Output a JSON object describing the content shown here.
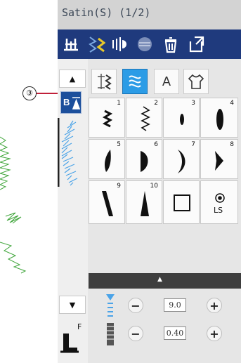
{
  "title": "Satin(S) (1/2)",
  "callout": {
    "label": "③"
  },
  "toolbar": {
    "icons": [
      "presser-foot-position-icon",
      "stitch-mirror-vertical-icon",
      "mirror-horizontal-icon",
      "hidden-icon",
      "delete-icon",
      "return-icon"
    ]
  },
  "tabs": [
    "stitch-group-icon",
    "satin-pattern-icon",
    "A",
    "shirt-icon"
  ],
  "scroll": {
    "up": "▲",
    "down": "▼"
  },
  "patterns": [
    {
      "num": "1"
    },
    {
      "num": "2"
    },
    {
      "num": "3"
    },
    {
      "num": "4"
    },
    {
      "num": "5"
    },
    {
      "num": "6"
    },
    {
      "num": "7"
    },
    {
      "num": "8"
    },
    {
      "num": "9"
    },
    {
      "num": "10"
    },
    {
      "num": ""
    },
    {
      "num": "",
      "label": "LS"
    }
  ],
  "width_value": "9.0",
  "density_value": "0.40",
  "minus": "−",
  "plus": "+",
  "foot": {
    "letter": "F"
  },
  "colors": {
    "toolbar": "#1f3a7d",
    "selected_tab": "#2c9ce6",
    "embroidery": "#3fa53a"
  }
}
